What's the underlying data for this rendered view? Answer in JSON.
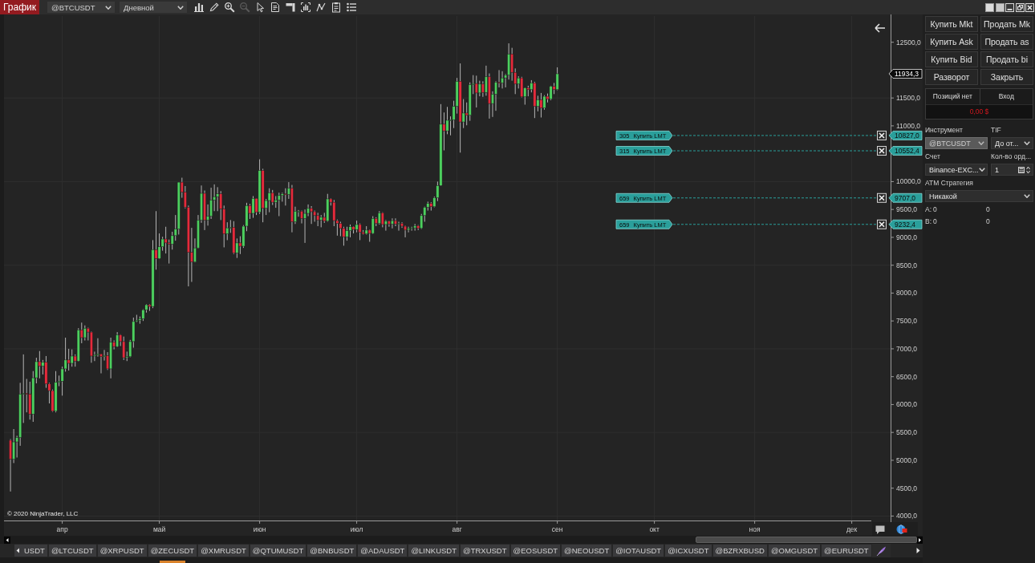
{
  "window": {
    "title": "График"
  },
  "toolbar": {
    "instrument": "@BTCUSDT",
    "period": "Дневной",
    "tools": [
      {
        "kind": "bars",
        "disabled": false
      },
      {
        "kind": "pencil",
        "disabled": false
      },
      {
        "kind": "zoom-in",
        "disabled": false
      },
      {
        "kind": "zoom-out",
        "disabled": true
      },
      {
        "kind": "pointer",
        "disabled": false
      },
      {
        "kind": "document",
        "disabled": false
      },
      {
        "kind": "panel",
        "disabled": false
      },
      {
        "kind": "frame",
        "disabled": false
      },
      {
        "kind": "line",
        "disabled": false
      },
      {
        "kind": "clipboard",
        "disabled": false
      },
      {
        "kind": "list",
        "disabled": false
      }
    ]
  },
  "chart": {
    "copyright": "© 2020 NinjaTrader, LLC",
    "last_price": "11934,3",
    "orders": [
      {
        "quantity": "305",
        "action": "Купить LMT",
        "price": "10827,0"
      },
      {
        "quantity": "315",
        "action": "Купить LMT",
        "price": "10552,4"
      },
      {
        "quantity": "659",
        "action": "Купить LMT",
        "price": "9707,0"
      },
      {
        "quantity": "659",
        "action": "Купить LMT",
        "price": "9232,4"
      }
    ],
    "chart_data": [
      {
        "type": "candlestick",
        "categories": [
          null,
          null,
          null,
          null,
          null,
          null,
          null,
          null,
          null,
          null,
          null,
          null,
          null,
          null,
          null,
          null,
          "апр",
          null,
          null,
          null,
          null,
          null,
          null,
          null,
          null,
          null,
          null,
          null,
          null,
          null,
          null,
          null,
          null,
          null,
          null,
          null,
          null,
          null,
          null,
          null,
          null,
          null,
          null,
          null,
          null,
          null,
          "май",
          null,
          null,
          null,
          null,
          null,
          null,
          null,
          null,
          null,
          null,
          null,
          null,
          null,
          null,
          null,
          null,
          null,
          null,
          null,
          null,
          null,
          null,
          null,
          null,
          null,
          null,
          null,
          null,
          null,
          null,
          "июн",
          null,
          null,
          null,
          null,
          null,
          null,
          null,
          null,
          null,
          null,
          null,
          null,
          null,
          null,
          null,
          null,
          null,
          null,
          null,
          null,
          null,
          null,
          null,
          null,
          null,
          null,
          null,
          null,
          null,
          "июл",
          null,
          null,
          null,
          null,
          null,
          null,
          null,
          null,
          null,
          null,
          null,
          null,
          null,
          null,
          null,
          null,
          null,
          null,
          null,
          null,
          null,
          null,
          null,
          null,
          null,
          null,
          null,
          null,
          null,
          null,
          "авг",
          null,
          null,
          null,
          null,
          null,
          null,
          null,
          null,
          null,
          null,
          null,
          null,
          null,
          null,
          null,
          null,
          null,
          null,
          null,
          null,
          null,
          null,
          null,
          null,
          null,
          null,
          null,
          null,
          null,
          null,
          "сен",
          null,
          null,
          null,
          null,
          null,
          null,
          null,
          null,
          null,
          null,
          null,
          null,
          null,
          null,
          null,
          null,
          null,
          null,
          null,
          null,
          null,
          null,
          null,
          null,
          null,
          null,
          null,
          null,
          null,
          "окт",
          null,
          null,
          null,
          null,
          null,
          null,
          null,
          null,
          null,
          null,
          null,
          null,
          null,
          null,
          null,
          null,
          null,
          null,
          null,
          null,
          null,
          null,
          null,
          null,
          null,
          null,
          null,
          null,
          null,
          null,
          "ноя",
          null,
          null,
          null,
          null,
          null,
          null,
          null,
          null,
          null,
          null,
          null,
          null,
          null,
          null,
          null,
          null,
          null,
          null,
          null,
          null,
          null,
          null,
          null,
          null,
          null,
          null,
          null,
          null,
          null,
          "дек",
          null,
          null,
          null,
          null,
          null,
          null,
          null,
          null,
          null,
          null,
          null
        ],
        "ohlc": [
          [
            5360,
            5380,
            4440,
            5020
          ],
          [
            5020,
            5560,
            4950,
            5330
          ],
          [
            5330,
            5440,
            5050,
            5410
          ],
          [
            5410,
            6390,
            5260,
            6190
          ],
          [
            6190,
            6900,
            5670,
            6200
          ],
          [
            6200,
            6460,
            5860,
            6190
          ],
          [
            6190,
            6410,
            5730,
            5830
          ],
          [
            5830,
            6600,
            5690,
            6480
          ],
          [
            6480,
            6840,
            6380,
            6770
          ],
          [
            6770,
            6960,
            6470,
            6690
          ],
          [
            6690,
            6800,
            6540,
            6760
          ],
          [
            6760,
            6870,
            6300,
            6370
          ],
          [
            6370,
            6390,
            6020,
            6250
          ],
          [
            6250,
            6270,
            5870,
            5880
          ],
          [
            5880,
            6600,
            5860,
            6400
          ],
          [
            6400,
            6520,
            6330,
            6420
          ],
          [
            6420,
            6680,
            6160,
            6640
          ],
          [
            6640,
            7200,
            6590,
            6800
          ],
          [
            6800,
            7000,
            6610,
            6740
          ],
          [
            6740,
            6990,
            6680,
            6870
          ],
          [
            6870,
            6900,
            6680,
            6780
          ],
          [
            6780,
            7370,
            6770,
            7340
          ],
          [
            7340,
            7470,
            7100,
            7200
          ],
          [
            7200,
            7420,
            7150,
            7370
          ],
          [
            7370,
            7380,
            7150,
            7300
          ],
          [
            7300,
            7310,
            6750,
            6870
          ],
          [
            6870,
            6950,
            6780,
            6890
          ],
          [
            6890,
            7190,
            6860,
            6910
          ],
          [
            6910,
            6910,
            6560,
            6860
          ],
          [
            6860,
            6980,
            6790,
            6880
          ],
          [
            6880,
            6940,
            6620,
            6640
          ],
          [
            6640,
            7200,
            6470,
            7120
          ],
          [
            7120,
            7150,
            6990,
            7040
          ],
          [
            7040,
            7300,
            7030,
            7250
          ],
          [
            7250,
            7260,
            7050,
            7130
          ],
          [
            7130,
            7220,
            6800,
            6840
          ],
          [
            6840,
            6950,
            6780,
            6860
          ],
          [
            6860,
            7160,
            6850,
            7130
          ],
          [
            7130,
            7560,
            7020,
            7490
          ],
          [
            7490,
            7610,
            7480,
            7510
          ],
          [
            7510,
            7580,
            7450,
            7540
          ],
          [
            7540,
            7710,
            7500,
            7700
          ],
          [
            7700,
            7800,
            7650,
            7790
          ],
          [
            7790,
            7800,
            7680,
            7760
          ],
          [
            7760,
            8950,
            7730,
            8780
          ],
          [
            8780,
            9470,
            8420,
            8620
          ],
          [
            8620,
            9070,
            8610,
            8830
          ],
          [
            8830,
            9010,
            8760,
            8970
          ],
          [
            8970,
            9190,
            8710,
            8900
          ],
          [
            8900,
            8960,
            8530,
            8880
          ],
          [
            8880,
            9100,
            8780,
            9030
          ],
          [
            9030,
            9400,
            8940,
            9150
          ],
          [
            9150,
            9990,
            9050,
            9990
          ],
          [
            9990,
            10070,
            9710,
            9810
          ],
          [
            9810,
            9920,
            9520,
            9540
          ],
          [
            9540,
            9570,
            8120,
            8730
          ],
          [
            8730,
            9170,
            8200,
            8560
          ],
          [
            8560,
            8980,
            8550,
            8810
          ],
          [
            8810,
            9400,
            8800,
            9310
          ],
          [
            9310,
            9930,
            9260,
            9790
          ],
          [
            9790,
            9840,
            9130,
            9310
          ],
          [
            9310,
            9590,
            9210,
            9380
          ],
          [
            9380,
            9890,
            9330,
            9670
          ],
          [
            9670,
            9950,
            9470,
            9730
          ],
          [
            9730,
            9900,
            9470,
            9780
          ],
          [
            9780,
            9830,
            9310,
            9510
          ],
          [
            9510,
            9570,
            8820,
            9060
          ],
          [
            9060,
            9270,
            8950,
            9170
          ],
          [
            9170,
            9310,
            9080,
            9180
          ],
          [
            9180,
            9290,
            8700,
            8720
          ],
          [
            8720,
            8980,
            8630,
            8900
          ],
          [
            8900,
            9020,
            8700,
            8840
          ],
          [
            8840,
            9220,
            8810,
            9200
          ],
          [
            9200,
            9620,
            9110,
            9570
          ],
          [
            9570,
            9600,
            9330,
            9430
          ],
          [
            9430,
            9740,
            9350,
            9700
          ],
          [
            9700,
            9700,
            9400,
            9450
          ],
          [
            9450,
            10400,
            9420,
            10200
          ],
          [
            10200,
            10230,
            9270,
            9520
          ],
          [
            9520,
            9690,
            9400,
            9660
          ],
          [
            9660,
            9880,
            9450,
            9800
          ],
          [
            9800,
            9850,
            9580,
            9630
          ],
          [
            9630,
            9740,
            9530,
            9670
          ],
          [
            9670,
            9800,
            9380,
            9750
          ],
          [
            9750,
            9800,
            9640,
            9780
          ],
          [
            9780,
            9880,
            9570,
            9770
          ],
          [
            9770,
            9990,
            9690,
            9880
          ],
          [
            9880,
            9940,
            9090,
            9280
          ],
          [
            9280,
            9550,
            9240,
            9470
          ],
          [
            9470,
            9490,
            9370,
            9470
          ],
          [
            9470,
            9480,
            9250,
            9340
          ],
          [
            9340,
            9500,
            8900,
            9430
          ],
          [
            9430,
            9590,
            9380,
            9520
          ],
          [
            9520,
            9560,
            9240,
            9460
          ],
          [
            9460,
            9480,
            9280,
            9390
          ],
          [
            9390,
            9440,
            9200,
            9310
          ],
          [
            9310,
            9400,
            9180,
            9360
          ],
          [
            9360,
            9440,
            9260,
            9290
          ],
          [
            9290,
            9780,
            9280,
            9690
          ],
          [
            9690,
            9700,
            9570,
            9630
          ],
          [
            9630,
            9670,
            9200,
            9300
          ],
          [
            9300,
            9320,
            9030,
            9250
          ],
          [
            9250,
            9280,
            9020,
            9160
          ],
          [
            9160,
            9190,
            8850,
            9010
          ],
          [
            9010,
            9190,
            8940,
            9120
          ],
          [
            9120,
            9230,
            9000,
            9190
          ],
          [
            9190,
            9200,
            9070,
            9140
          ],
          [
            9140,
            9300,
            9090,
            9230
          ],
          [
            9230,
            9250,
            8950,
            9090
          ],
          [
            9090,
            9130,
            9050,
            9060
          ],
          [
            9060,
            9200,
            9050,
            9130
          ],
          [
            9130,
            9140,
            8920,
            9070
          ],
          [
            9070,
            9380,
            9060,
            9340
          ],
          [
            9340,
            9360,
            9200,
            9250
          ],
          [
            9250,
            9470,
            9230,
            9440
          ],
          [
            9440,
            9450,
            9180,
            9230
          ],
          [
            9230,
            9310,
            9120,
            9290
          ],
          [
            9290,
            9300,
            9190,
            9240
          ],
          [
            9240,
            9340,
            9160,
            9300
          ],
          [
            9300,
            9340,
            9200,
            9240
          ],
          [
            9240,
            9280,
            9120,
            9250
          ],
          [
            9250,
            9270,
            9170,
            9200
          ],
          [
            9200,
            9210,
            9000,
            9130
          ],
          [
            9130,
            9190,
            9090,
            9160
          ],
          [
            9160,
            9190,
            9120,
            9170
          ],
          [
            9170,
            9240,
            9120,
            9210
          ],
          [
            9210,
            9220,
            9130,
            9160
          ],
          [
            9160,
            9420,
            9150,
            9390
          ],
          [
            9390,
            9550,
            9280,
            9540
          ],
          [
            9540,
            9640,
            9480,
            9610
          ],
          [
            9610,
            9630,
            9480,
            9550
          ],
          [
            9550,
            9730,
            9540,
            9710
          ],
          [
            9710,
            10000,
            9650,
            9930
          ],
          [
            9930,
            11390,
            9920,
            11030
          ],
          [
            11030,
            11240,
            10560,
            10910
          ],
          [
            10910,
            11340,
            10850,
            11100
          ],
          [
            11100,
            11170,
            10830,
            11110
          ],
          [
            11110,
            11450,
            10960,
            11350
          ],
          [
            11350,
            11860,
            11220,
            11800
          ],
          [
            11800,
            12120,
            10520,
            11070
          ],
          [
            11070,
            11480,
            10960,
            11230
          ],
          [
            11230,
            11420,
            11010,
            11190
          ],
          [
            11190,
            11780,
            11090,
            11740
          ],
          [
            11740,
            11910,
            11570,
            11760
          ],
          [
            11760,
            11900,
            11330,
            11590
          ],
          [
            11590,
            11810,
            11530,
            11750
          ],
          [
            11750,
            11800,
            11520,
            11600
          ],
          [
            11600,
            12080,
            11540,
            11880
          ],
          [
            11880,
            11940,
            11130,
            11400
          ],
          [
            11400,
            11620,
            11160,
            11570
          ],
          [
            11570,
            11800,
            11270,
            11780
          ],
          [
            11780,
            12000,
            11690,
            11770
          ],
          [
            11770,
            11980,
            11670,
            11860
          ],
          [
            11860,
            11930,
            11690,
            11910
          ],
          [
            11910,
            12480,
            11830,
            12290
          ],
          [
            12290,
            12400,
            11810,
            11960
          ],
          [
            11960,
            12030,
            11570,
            11750
          ],
          [
            11750,
            11890,
            11670,
            11860
          ],
          [
            11860,
            11880,
            11510,
            11520
          ],
          [
            11520,
            11690,
            11380,
            11680
          ],
          [
            11680,
            11720,
            11530,
            11650
          ],
          [
            11650,
            11820,
            11600,
            11770
          ],
          [
            11770,
            11790,
            11140,
            11350
          ],
          [
            11350,
            11540,
            11260,
            11470
          ],
          [
            11470,
            11590,
            11150,
            11320
          ],
          [
            11320,
            11550,
            11290,
            11530
          ],
          [
            11530,
            11580,
            11420,
            11480
          ],
          [
            11480,
            11720,
            11460,
            11710
          ],
          [
            11710,
            11770,
            11570,
            11650
          ],
          [
            11650,
            12050,
            11640,
            11934.3
          ],
          null,
          null,
          null,
          null,
          null,
          null,
          null,
          null,
          null,
          null,
          null,
          null,
          null,
          null,
          null,
          null,
          null,
          null,
          null,
          null,
          null,
          null,
          null,
          null,
          null,
          null,
          null,
          null,
          null,
          null,
          null,
          null,
          null,
          null,
          null,
          null,
          null,
          null,
          null,
          null,
          null,
          null,
          null,
          null,
          null,
          null,
          null,
          null,
          null,
          null,
          null,
          null,
          null,
          null,
          null,
          null,
          null,
          null,
          null,
          null,
          null,
          null,
          null,
          null,
          null,
          null,
          null,
          null,
          null,
          null,
          null,
          null,
          null,
          null,
          null,
          null,
          null,
          null,
          null,
          null,
          null,
          null,
          null,
          null,
          null,
          null,
          null,
          null,
          null,
          null,
          null,
          null,
          null,
          null,
          null,
          null,
          null,
          null,
          null,
          null,
          null,
          null
        ],
        "ylim": [
          3920,
          12970
        ],
        "yticks": [
          {
            "value": 4000,
            "label": "4000,0"
          },
          {
            "value": 4500,
            "label": "4500,0"
          },
          {
            "value": 5000,
            "label": "5000,0"
          },
          {
            "value": 5500,
            "label": "5500,0"
          },
          {
            "value": 6000,
            "label": "6000,0"
          },
          {
            "value": 6500,
            "label": "6500,0"
          },
          {
            "value": 7000,
            "label": "7000,0"
          },
          {
            "value": 7500,
            "label": "7500,0"
          },
          {
            "value": 8000,
            "label": "8000,0"
          },
          {
            "value": 8500,
            "label": "8500,0"
          },
          {
            "value": 9000,
            "label": "9000,0"
          },
          {
            "value": 9500,
            "label": "9500,0"
          },
          {
            "value": 10000,
            "label": "10000,0"
          },
          {
            "value": 11000,
            "label": "11000,0"
          },
          {
            "value": 11500,
            "label": "11500,0"
          },
          {
            "value": 12500,
            "label": "12500,0"
          }
        ],
        "grid": true,
        "ref_lines": [
          {
            "axis": "y",
            "value": 10827,
            "color": "#2a9f9b",
            "line_style": "dashed"
          },
          {
            "axis": "y",
            "value": 10552.4,
            "color": "#2a9f9b",
            "line_style": "dashed"
          },
          {
            "axis": "y",
            "value": 9707,
            "color": "#2a9f9b",
            "line_style": "dashed"
          },
          {
            "axis": "y",
            "value": 9232.4,
            "color": "#2a9f9b",
            "line_style": "dashed"
          }
        ]
      }
    ]
  },
  "instrument_tabs": [
    {
      "label": "USDT",
      "selected": false
    },
    {
      "label": "@LTCUSDT",
      "selected": false
    },
    {
      "label": "@XRPUSDT",
      "selected": false
    },
    {
      "label": "@ZECUSDT",
      "selected": false
    },
    {
      "label": "@XMRUSDT",
      "selected": false
    },
    {
      "label": "@QTUMUSDT",
      "selected": false
    },
    {
      "label": "@BNBUSDT",
      "selected": false
    },
    {
      "label": "@ADAUSDT",
      "selected": false
    },
    {
      "label": "@LINKUSDT",
      "selected": false
    },
    {
      "label": "@TRXUSDT",
      "selected": false
    },
    {
      "label": "@EOSUSDT",
      "selected": false
    },
    {
      "label": "@NEOUSDT",
      "selected": false
    },
    {
      "label": "@IOTAUSDT",
      "selected": false
    },
    {
      "label": "@ICXUSDT",
      "selected": false
    },
    {
      "label": "@BZRXBUSD",
      "selected": false
    },
    {
      "label": "@OMGUSDT",
      "selected": false
    },
    {
      "label": "@EURUSDT",
      "selected": false
    }
  ],
  "order_panel": {
    "buttons": [
      "Купить Mkt",
      "Продать Mk",
      "Купить Ask",
      "Продать as",
      "Купить Bid",
      "Продать bi",
      "Разворот",
      "Закрыть"
    ],
    "position": {
      "status": "Позиций нет",
      "entry": "Вход",
      "pnl": "0,00 $"
    },
    "fields": [
      {
        "label": "Инструмент",
        "value": "@BTCUSDT",
        "kind": "select",
        "disabled": true
      },
      {
        "label": "TIF",
        "value": "До от...",
        "kind": "select",
        "disabled": false
      },
      {
        "label": "Счет",
        "value": "Binance-EXC...",
        "kind": "select",
        "disabled": false
      },
      {
        "label": "Кол-во орд...",
        "value": "1",
        "kind": "spinner",
        "disabled": false
      }
    ],
    "atm_strategy": {
      "label": "ATM Стратегия",
      "value": "Никакой"
    },
    "counters": [
      {
        "label": "A:",
        "value": "0",
        "value_2": "0"
      },
      {
        "label": "B:",
        "value": "0",
        "value_2": "0"
      }
    ]
  }
}
